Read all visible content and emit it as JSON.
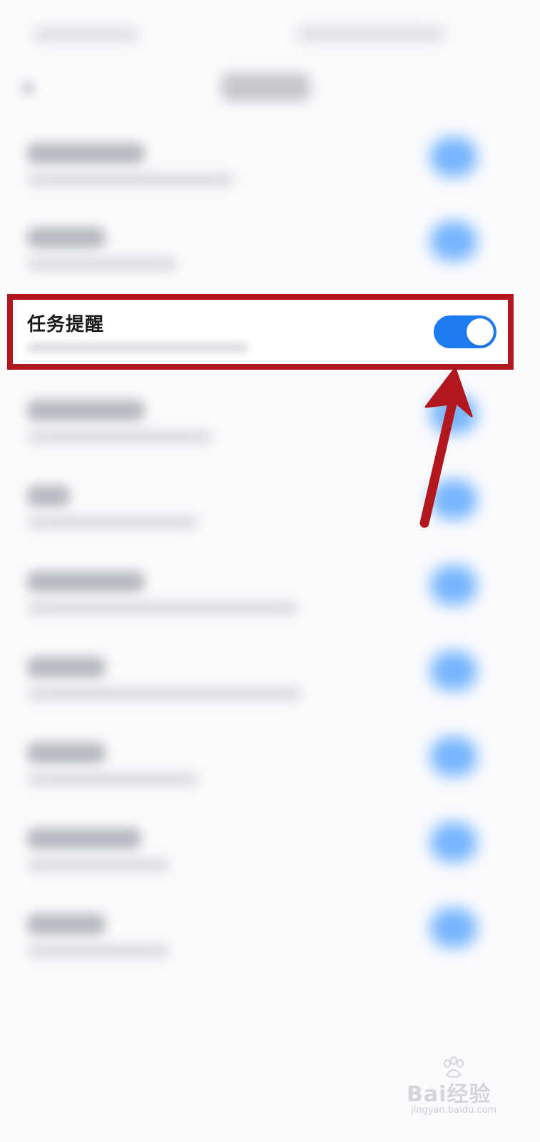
{
  "setting": {
    "title": "任务提醒",
    "enabled": true
  },
  "colors": {
    "toggle_on": "#1e7cf2",
    "highlight_frame": "#b1171c",
    "arrow": "#b1171c"
  },
  "watermark": {
    "main": "Bai经验",
    "sub": "jingyan.baidu.com"
  }
}
